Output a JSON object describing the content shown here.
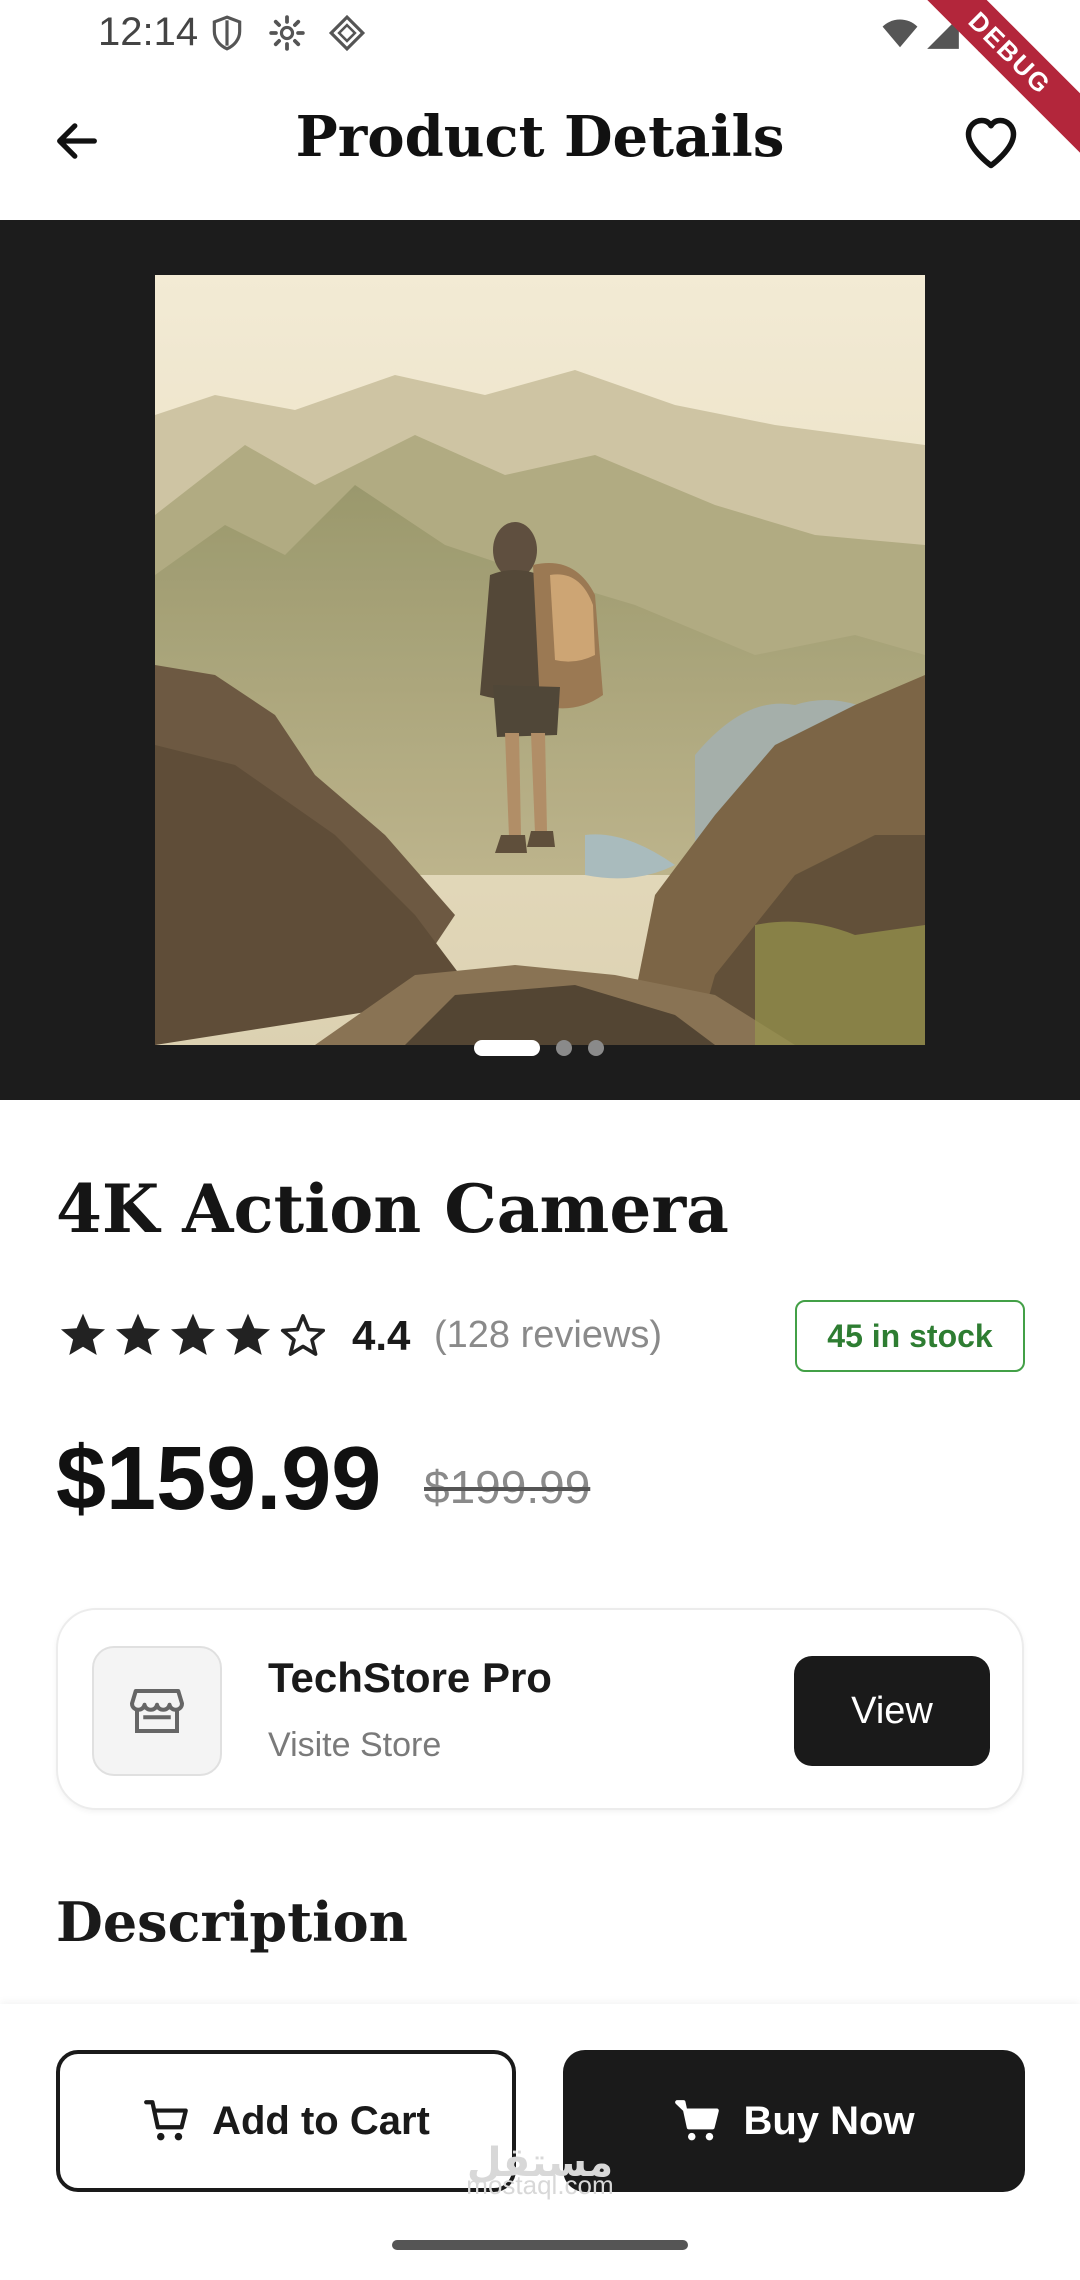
{
  "status_bar": {
    "time": "12:14",
    "icons": [
      "shield-icon",
      "settings-gear-icon",
      "debug-diamond-icon",
      "wifi-icon",
      "signal-icon",
      "battery-icon"
    ],
    "debug_label": "DEBUG"
  },
  "app_bar": {
    "title": "Product Details",
    "back_icon": "arrow-left-icon",
    "favorite_icon": "heart-outline-icon"
  },
  "carousel": {
    "image_description": "photo",
    "slide_count": 3,
    "active_index": 0
  },
  "product": {
    "title": "4K Action Camera",
    "rating": "4.4",
    "rating_stars": {
      "filled": 4,
      "total": 5
    },
    "reviews": "(128 reviews)",
    "stock": "45 in stock",
    "price": "$159.99",
    "old_price": "$199.99"
  },
  "store": {
    "icon": "storefront-icon",
    "name": "TechStore Pro",
    "subtitle": "Visite Store",
    "view_label": "View"
  },
  "description": {
    "title": "Description"
  },
  "actions": {
    "add_to_cart_label": "Add to Cart",
    "buy_now_label": "Buy Now",
    "cart_icon": "shopping-cart-icon"
  },
  "watermark": {
    "arabic": "مستقل",
    "latin": "mostaql.com"
  },
  "colors": {
    "accent": "#1a1a1a",
    "stock_green": "#43a047",
    "carousel_bg": "#1c1c1c",
    "debug_red": "#b3263b"
  }
}
